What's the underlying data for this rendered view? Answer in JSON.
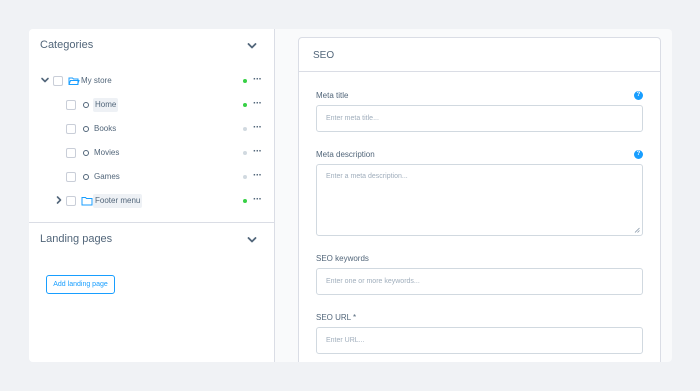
{
  "sidebar": {
    "categories": {
      "title": "Categories",
      "tree": [
        {
          "label": "My store",
          "status": "active",
          "expanded": true
        },
        {
          "label": "Home",
          "status": "active"
        },
        {
          "label": "Books",
          "status": "inactive"
        },
        {
          "label": "Movies",
          "status": "inactive"
        },
        {
          "label": "Games",
          "status": "inactive"
        },
        {
          "label": "Footer menu",
          "status": "active",
          "expanded": false
        }
      ],
      "more_label": "···"
    },
    "landing_pages": {
      "title": "Landing pages",
      "add_button": "Add landing page"
    }
  },
  "seo": {
    "title": "SEO",
    "meta_title": {
      "label": "Meta title",
      "placeholder": "Enter meta title..."
    },
    "meta_description": {
      "label": "Meta description",
      "placeholder": "Enter a meta description..."
    },
    "keywords": {
      "label": "SEO keywords",
      "placeholder": "Enter one or more keywords..."
    },
    "url": {
      "label": "SEO URL *",
      "placeholder": "Enter URL..."
    },
    "help_glyph": "?"
  },
  "colors": {
    "accent": "#189eff",
    "active_dot": "#37d046",
    "inactive_dot": "#d1d9e0",
    "text": "#52667a"
  }
}
